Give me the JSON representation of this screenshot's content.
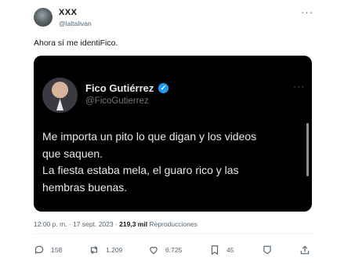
{
  "author": {
    "name": "XXX",
    "handle": "@laltalivan"
  },
  "tweet_text": "Ahora sí me identiFico.",
  "quoted": {
    "name": "Fico Gutiérrez",
    "handle": "@FicoGutierrez",
    "text_lines": [
      "Me importa un pito lo que digan y los videos",
      "que saquen.",
      "La fiesta estaba mela, el guaro rico y las",
      "hembras buenas."
    ]
  },
  "meta": {
    "time": "12:00 p. m. · 17 sept. 2023 ·",
    "views": "219,3 mil",
    "views_label": "Reproducciones"
  },
  "actions": {
    "replies": "158",
    "retweets": "1.209",
    "likes": "6.725",
    "bookmarks": "45"
  },
  "icons": [
    "more-icon",
    "verified-icon",
    "reply-icon",
    "retweet-icon",
    "like-icon",
    "bookmark-icon",
    "grok-icon",
    "share-icon"
  ],
  "colors": {
    "accent": "#1d9bf0",
    "muted": "#536471",
    "card_bg": "#000000"
  }
}
